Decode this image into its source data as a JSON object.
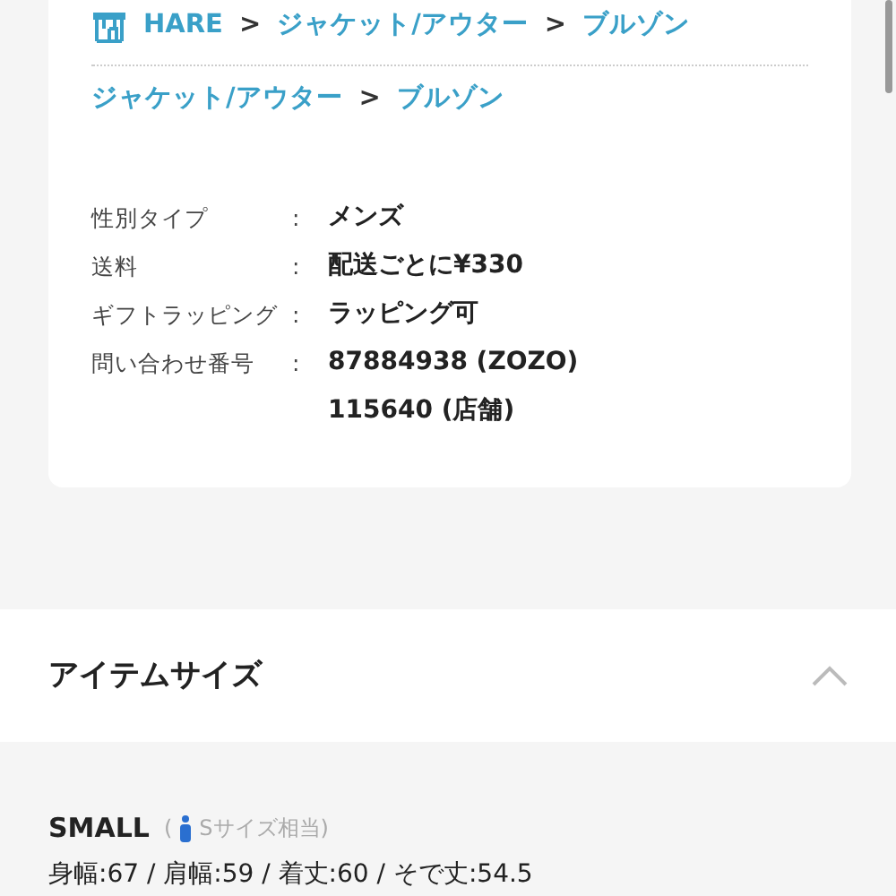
{
  "breadcrumb_shop": [
    {
      "kind": "link",
      "text": "HARE"
    },
    {
      "kind": "separator",
      "text": ">"
    },
    {
      "kind": "link",
      "text": "ジャケット/アウター"
    },
    {
      "kind": "separator",
      "text": ">"
    },
    {
      "kind": "link",
      "text": "ブルゾン"
    }
  ],
  "breadcrumb_category": [
    {
      "kind": "link",
      "text": "ジャケット/アウター"
    },
    {
      "kind": "separator",
      "text": ">"
    },
    {
      "kind": "link",
      "text": "ブルゾン"
    }
  ],
  "details": [
    {
      "label": "性別タイプ",
      "colon": ":",
      "values": [
        "メンズ"
      ]
    },
    {
      "label": "送料",
      "colon": ":",
      "values": [
        "配送ごとに¥330"
      ]
    },
    {
      "label": "ギフトラッピング",
      "colon": ":",
      "values": [
        "ラッピング可"
      ]
    },
    {
      "label": "問い合わせ番号",
      "colon": ":",
      "values": [
        "87884938 (ZOZO)",
        "115640 (店舗)"
      ]
    }
  ],
  "item_size": {
    "title": "アイテムサイズ",
    "expanded": true,
    "sizes": [
      {
        "name": "SMALL",
        "open": "(",
        "equivalent": "Sサイズ相当)",
        "measurements": "身幅:67 / 肩幅:59 / 着丈:60 / そで丈:54.5"
      }
    ]
  }
}
